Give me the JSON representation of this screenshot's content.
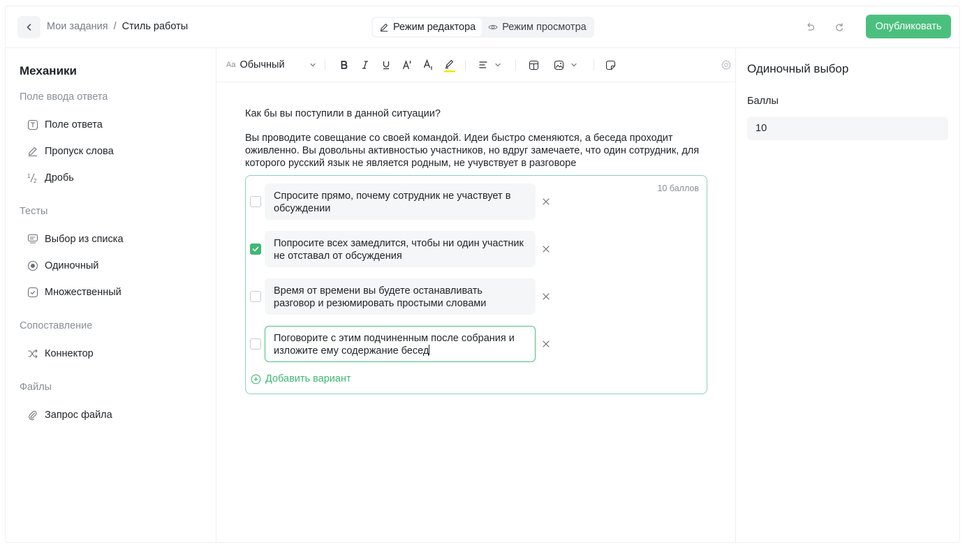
{
  "header": {
    "breadcrumb_parent": "Мои задания",
    "breadcrumb_separator": "/",
    "breadcrumb_current": "Стиль работы",
    "mode_editor": "Режим редактора",
    "mode_preview": "Режим просмотра",
    "publish_label": "Опубликовать"
  },
  "sidebar": {
    "title": "Механики",
    "groups": [
      {
        "label": "Поле ввода ответа",
        "items": [
          {
            "label": "Поле ответа",
            "icon": "text-field-icon"
          },
          {
            "label": "Пропуск слова",
            "icon": "pencil-icon"
          },
          {
            "label": "Дробь",
            "icon": "fraction-icon"
          }
        ]
      },
      {
        "label": "Тесты",
        "items": [
          {
            "label": "Выбор из списка",
            "icon": "list-select-icon"
          },
          {
            "label": "Одиночный",
            "icon": "radio-icon"
          },
          {
            "label": "Множественный",
            "icon": "checkbox-icon"
          }
        ]
      },
      {
        "label": "Сопоставление",
        "items": [
          {
            "label": "Коннектор",
            "icon": "shuffle-icon"
          }
        ]
      },
      {
        "label": "Файлы",
        "items": [
          {
            "label": "Запрос файла",
            "icon": "paperclip-icon"
          }
        ]
      }
    ]
  },
  "toolbar": {
    "style_prefix": "Aa",
    "style_value": "Обычный"
  },
  "editor": {
    "question_title": "Как бы вы поступили в данной ситуации?",
    "question_body": "Вы проводите совещание со своей командой. Идеи быстро сменяются, а беседа проходит оживленно. Вы довольны активностью участников, но вдруг замечаете, что один сотрудник, для которого русский язык не является родным, не учувствует в разговоре",
    "points_badge": "10 баллов",
    "options": [
      {
        "text": "Спросите прямо, почему сотрудник не участвует в обсуждении",
        "checked": false
      },
      {
        "text": "Попросите всех замедлится, чтобы ни один участник не отставал от обсуждения",
        "checked": true
      },
      {
        "text": "Время от времени вы будете останавливать разговор и резюмировать простыми словами",
        "checked": false
      },
      {
        "text": "Поговорите с этим подчиненным после собрания и изложите ему содержание бесед",
        "checked": false
      }
    ],
    "add_option_label": "Добавить вариант"
  },
  "right_panel": {
    "title": "Одиночный выбор",
    "points_label": "Баллы",
    "points_value": "10"
  },
  "colors": {
    "accent": "#4bc07e",
    "box_border": "#8ed0c2",
    "highlight": "#f2e600"
  }
}
